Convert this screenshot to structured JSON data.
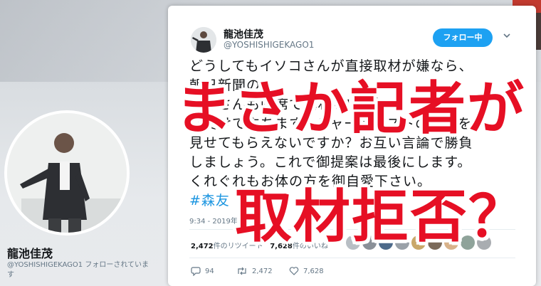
{
  "profile": {
    "name": "龍池佳茂",
    "handle_line": "@YOSHISHIGEKAGO1  フォローされていま",
    "handle_line2": "す"
  },
  "tweet": {
    "author_name": "龍池佳茂",
    "author_handle": "@YOSHISHIGEKAGO1",
    "follow_label": "フォロー中",
    "lines": [
      "どうしてもイソコさんが直接取材が嫌なら、",
      "朝日新聞の                              ",
      "相澤さんも同席で構わない   が  ",
      "は受けて立ちます。ジャーナリストの意地を",
      "見せてもらえないですか？お互い言論で勝負",
      "しましょう。これで御提案は最後にします。",
      "くれぐれもお体の方を御自愛下さい。"
    ],
    "hashtag": "#森友",
    "timestamp": "9:34 - 2019年",
    "retweets_count": "2,472",
    "retweets_label": "件のリツイート",
    "likes_count": "7,628",
    "likes_label": "件のいいね",
    "reply_count": "94",
    "retweet_action_count": "2,472",
    "like_action_count": "7,628"
  },
  "overlay": {
    "headline1": "まさか記者が",
    "headline2": "取材拒否？"
  },
  "colors": {
    "twitter_blue": "#1da1f2",
    "overlay_red": "#e60f24"
  }
}
